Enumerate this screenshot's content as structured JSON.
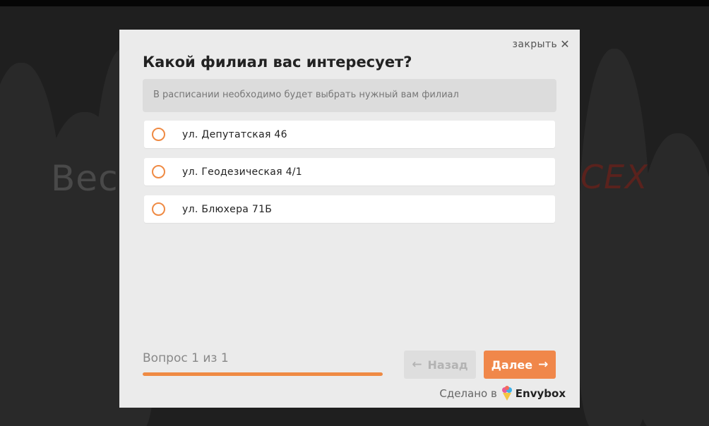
{
  "modal": {
    "close_label": "закрыть",
    "title": "Какой филиал вас интересует?",
    "hint": "В расписании необходимо будет выбрать нужный вам филиал",
    "options": [
      {
        "label": "ул. Депутатская 46"
      },
      {
        "label": "ул. Геодезическая 4/1"
      },
      {
        "label": "ул. Блюхера 71Б"
      }
    ],
    "progress": {
      "text": "Вопрос 1 из 1",
      "fraction": 1.0
    },
    "back_label": "Назад",
    "next_label": "Далее",
    "made_by": "Сделано в",
    "brand": "Envybox"
  },
  "background": {
    "text_left": "Вес",
    "text_right": "СЕХ"
  },
  "colors": {
    "accent": "#ef8a43",
    "modal_bg": "#ebebeb"
  }
}
